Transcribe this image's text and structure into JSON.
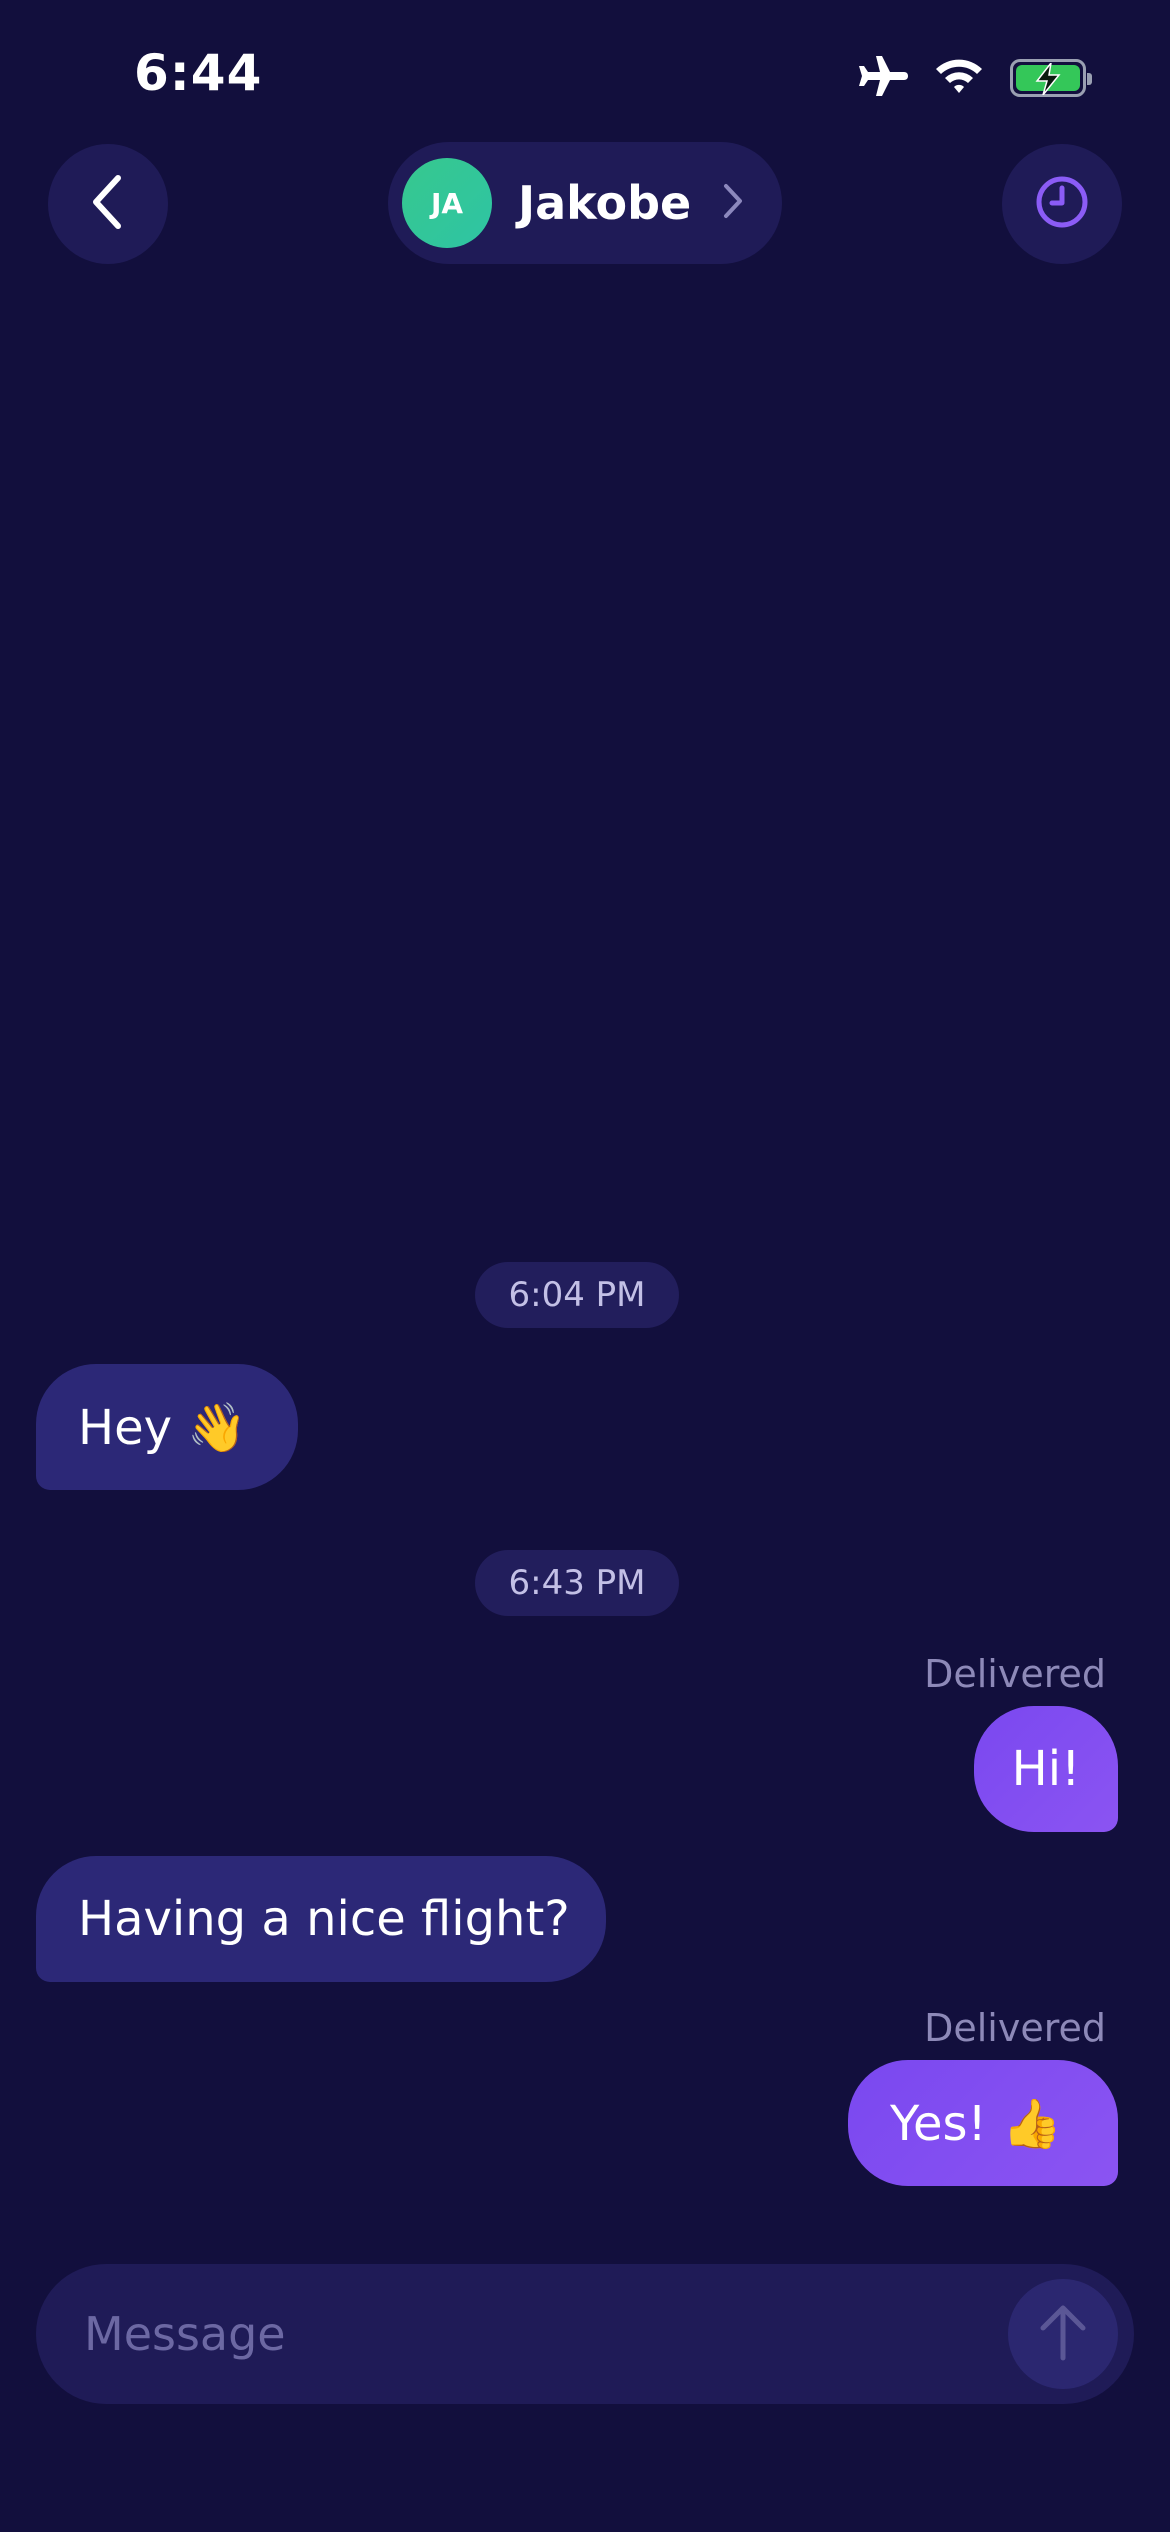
{
  "status_bar": {
    "time": "6:44"
  },
  "header": {
    "contact": {
      "initials": "JA",
      "name": "Jakobe"
    }
  },
  "messages": [
    {
      "type": "timestamp",
      "text": "6:04 PM"
    },
    {
      "type": "incoming",
      "text": "Hey 👋"
    },
    {
      "type": "timestamp",
      "text": "6:43 PM"
    },
    {
      "type": "outgoing",
      "text": "Hi!",
      "status": "Delivered"
    },
    {
      "type": "incoming",
      "text": "Having a nice flight?"
    },
    {
      "type": "outgoing",
      "text": "Yes! 👍",
      "status": "Delivered"
    }
  ],
  "composer": {
    "placeholder": "Message"
  },
  "colors": {
    "background": "#120f3d",
    "incoming_bubble": "#2c2877",
    "outgoing_bubble": "#7a48f0",
    "avatar": "#37c88e",
    "accent": "#8b5cf6"
  }
}
